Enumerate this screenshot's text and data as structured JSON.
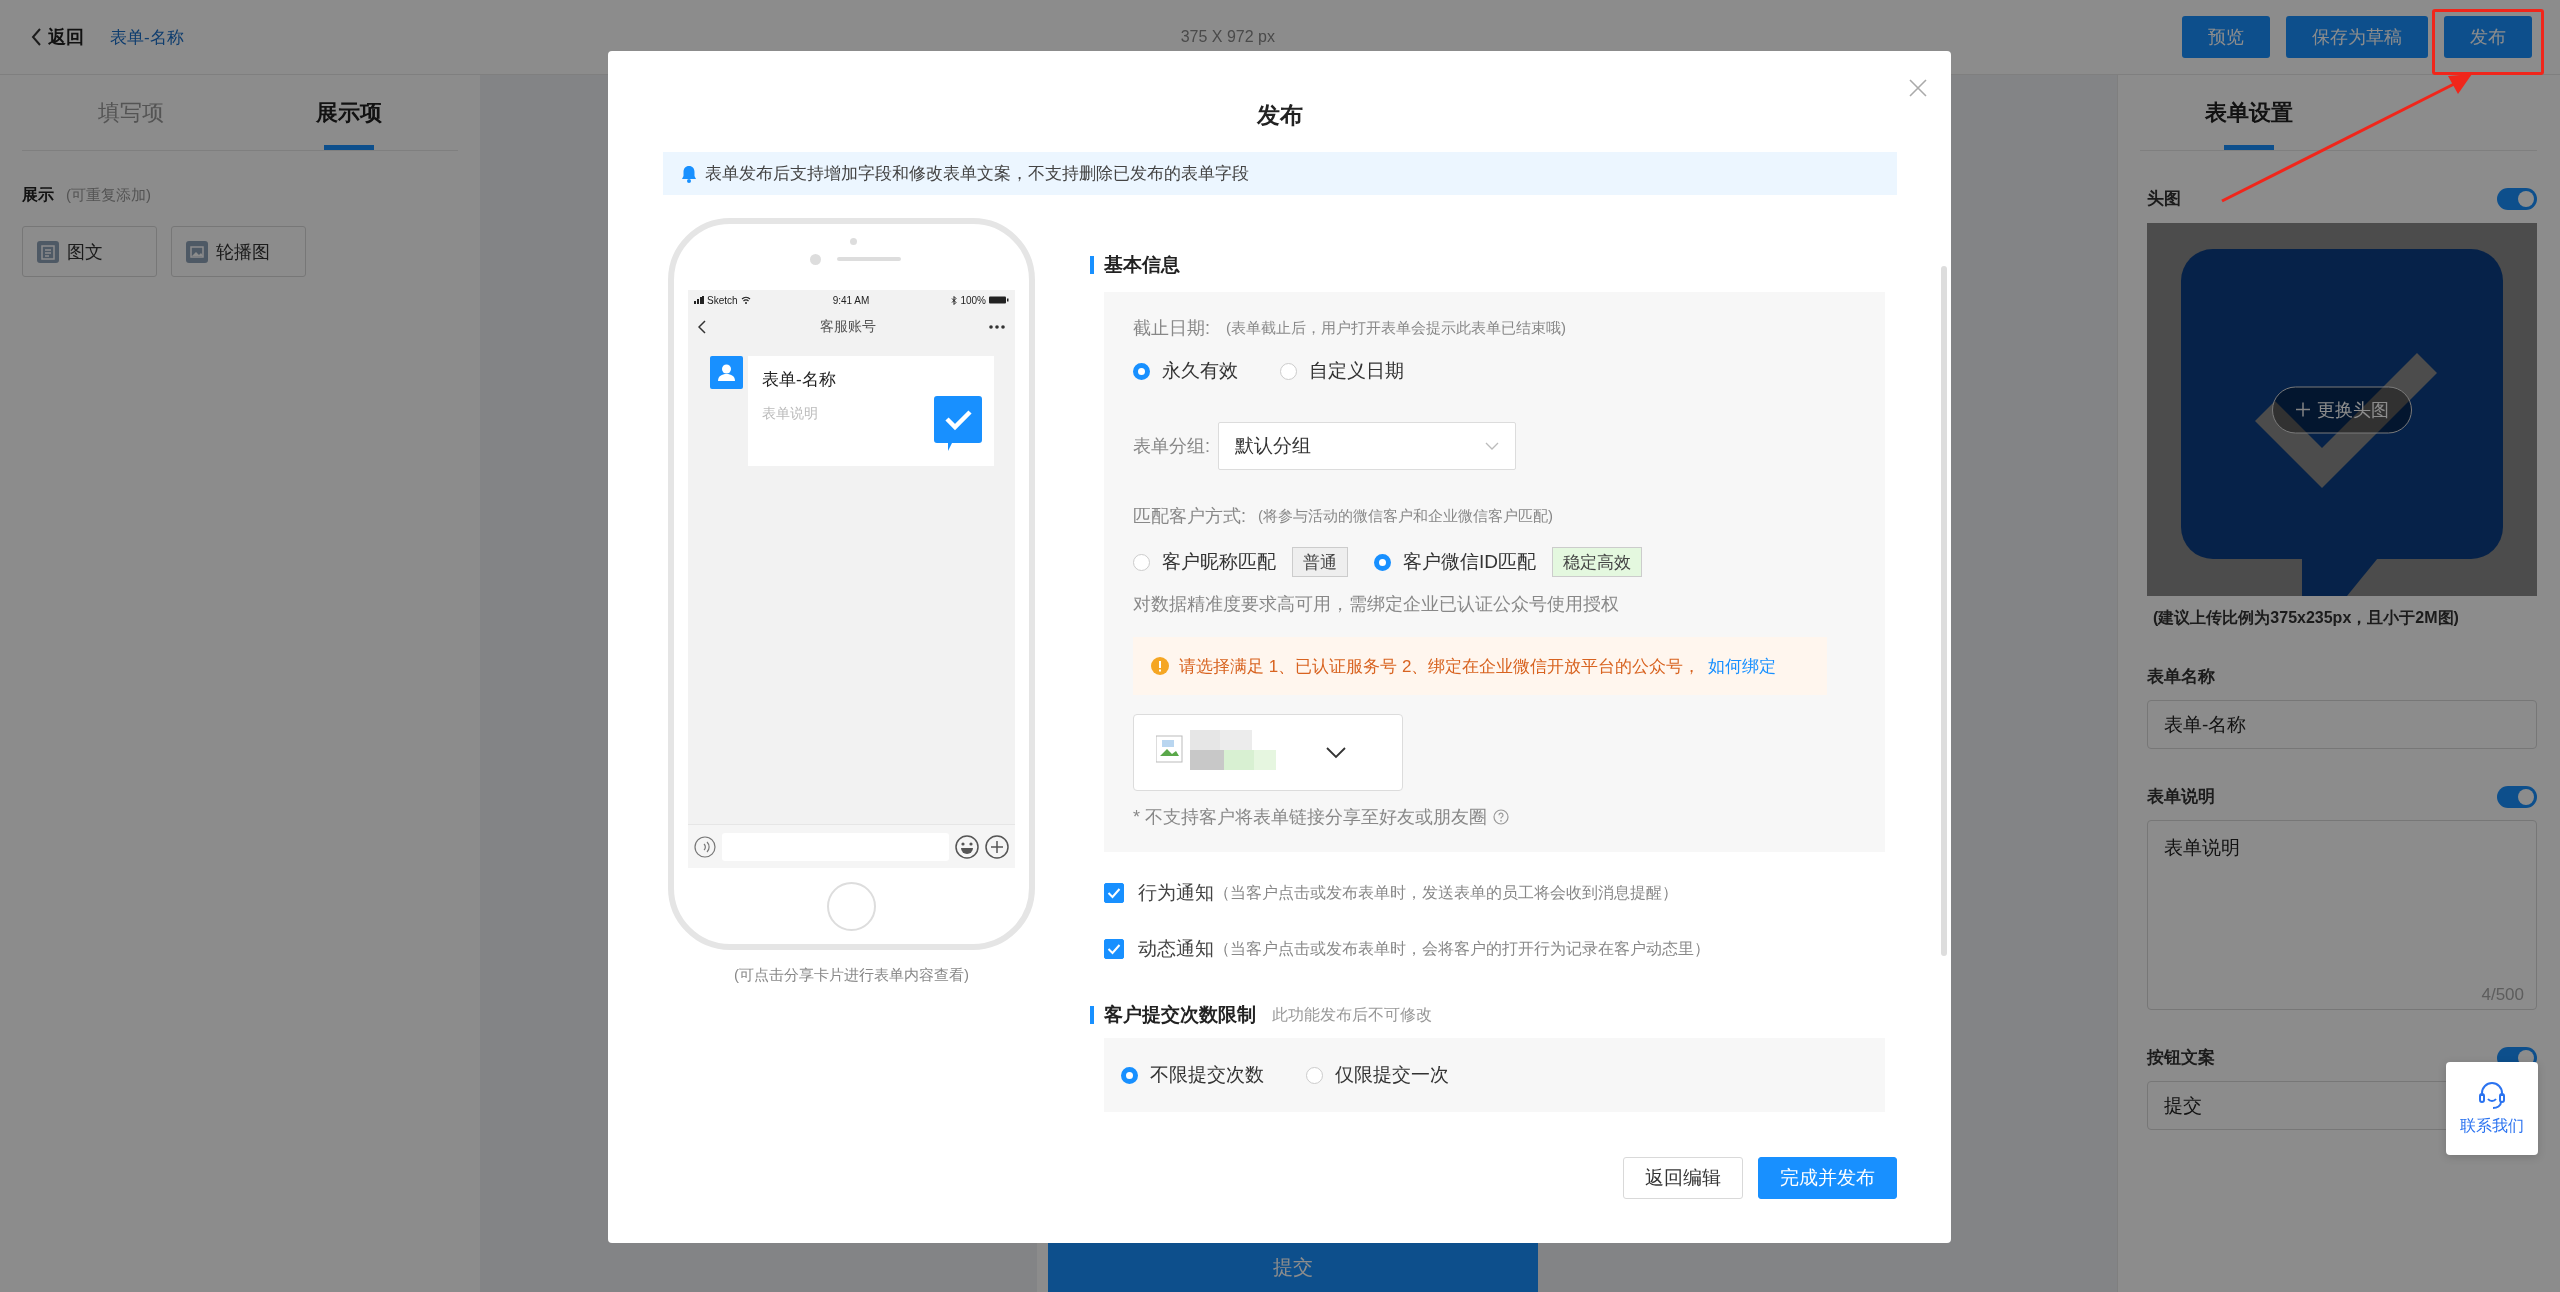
{
  "topbar": {
    "back": "返回",
    "form_name": "表单-名称",
    "canvas_size": "375 X 972 px",
    "buttons": [
      {
        "label": "预览"
      },
      {
        "label": "保存为草稿"
      },
      {
        "label": "发布"
      }
    ]
  },
  "annotation": {
    "kind": "arrow-frame"
  },
  "left_panel": {
    "tabs": [
      {
        "label": "填写项",
        "selected": false
      },
      {
        "label": "展示项",
        "selected": true
      }
    ],
    "section_title": "展示",
    "section_hint": "(可重复添加)",
    "items": [
      {
        "label": "图文",
        "kind": "article"
      },
      {
        "label": "轮播图",
        "kind": "carousel"
      }
    ]
  },
  "canvas": {
    "submit_button": "提交"
  },
  "right_panel": {
    "tabs": [
      {
        "label": "表单设置",
        "selected": true
      }
    ],
    "header_image": {
      "label": "头图",
      "on": true,
      "change_button": "更换头图",
      "hint": "(建议上传比例为375x235px，且小于2M图)"
    },
    "name": {
      "label": "表单名称",
      "value": "表单-名称"
    },
    "description": {
      "label": "表单说明",
      "on": true,
      "value": "表单说明",
      "counter": "4/500"
    },
    "button_text": {
      "label": "按钮文案",
      "on": true,
      "value": "提交"
    }
  },
  "contact_widget": {
    "label": "联系我们"
  },
  "dialog": {
    "title": "发布",
    "notice": "表单发布后支持增加字段和修改表单文案，不支持删除已发布的表单字段",
    "preview": {
      "carrier": "Sketch",
      "time": "9:41 AM",
      "battery": "100%",
      "chat_title": "客服账号",
      "card_title": "表单-名称",
      "card_desc": "表单说明",
      "caption": "(可点击分享卡片进行表单内容查看)"
    },
    "basic": {
      "title": "基本信息",
      "deadline": {
        "label": "截止日期:",
        "hint": "(表单截止后，用户打开表单会提示此表单已结束哦)",
        "options": [
          {
            "label": "永久有效",
            "selected": true
          },
          {
            "label": "自定义日期",
            "selected": false
          }
        ]
      },
      "group": {
        "label": "表单分组:",
        "value": "默认分组"
      },
      "match": {
        "label": "匹配客户方式:",
        "hint": "(将参与活动的微信客户和企业微信客户匹配)",
        "options": [
          {
            "label": "客户昵称匹配",
            "selected": false,
            "tag": "普通",
            "color": "#eeeeee"
          },
          {
            "label": "客户微信ID匹配",
            "selected": true,
            "tag": "稳定高效",
            "color": "#e4f8df"
          }
        ],
        "note": "对数据精准度要求高可用，需绑定企业已认证公众号使用授权",
        "warning": "请选择满足 1、已认证服务号 2、绑定在企业微信开放平台的公众号，",
        "warning_link": "如何绑定",
        "share_note": "* 不支持客户将表单链接分享至好友或朋友圈"
      }
    },
    "notifications": [
      {
        "label": "行为通知",
        "hint": "（当客户点击或发布表单时，发送表单的员工将会收到消息提醒）",
        "checked": true
      },
      {
        "label": "动态通知",
        "hint": "（当客户点击或发布表单时，会将客户的打开行为记录在客户动态里）",
        "checked": true
      }
    ],
    "limit": {
      "title": "客户提交次数限制",
      "hint": "此功能发布后不可修改",
      "options": [
        {
          "label": "不限提交次数",
          "selected": true
        },
        {
          "label": "仅限提交一次",
          "selected": false
        }
      ]
    },
    "buttons": [
      {
        "label": "返回编辑",
        "kind": "secondary"
      },
      {
        "label": "完成并发布",
        "kind": "primary"
      }
    ]
  }
}
